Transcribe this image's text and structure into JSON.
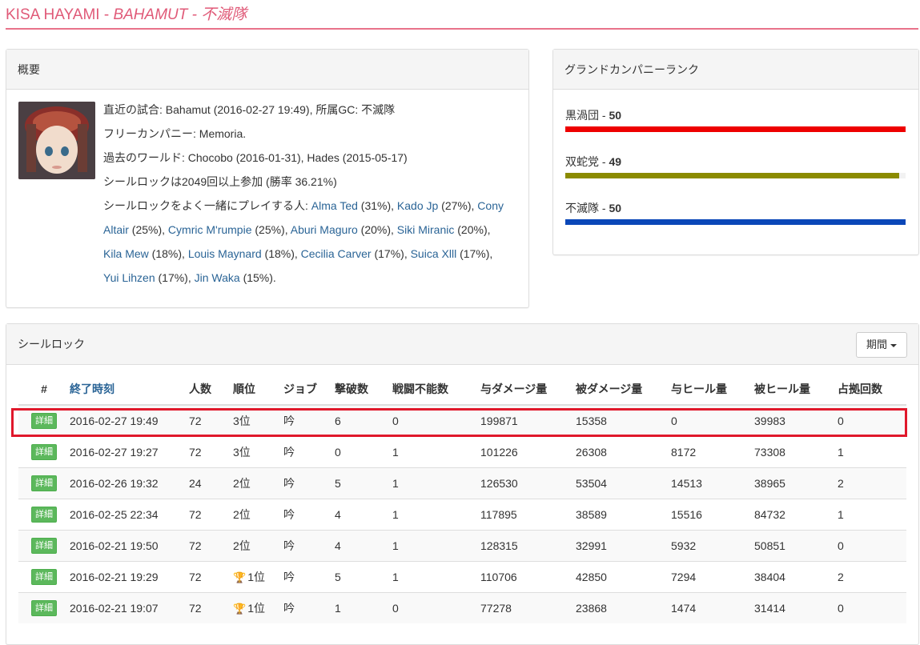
{
  "header": {
    "player": "KISA HAYAMI",
    "sep1": " - ",
    "world": "BAHAMUT",
    "sep2": " - ",
    "gc": "不滅隊",
    "accent": "#e05a78"
  },
  "overview": {
    "title": "概要",
    "line1": "直近の試合: Bahamut (2016-02-27 19:49), 所属GC: 不滅隊",
    "line2": "フリーカンパニー: Memoria.",
    "line3": "過去のワールド: Chocobo (2016-01-31), Hades (2015-05-17)",
    "line4": "シールロックは2049回以上参加 (勝率 36.21%)",
    "partners_prefix": "シールロックをよく一緒にプレイする人: ",
    "partners": [
      {
        "name": "Alma Ted",
        "pct": " (31%), "
      },
      {
        "name": "Kado Jp",
        "pct": " (27%), "
      },
      {
        "name": "Cony Altair",
        "pct": " (25%), "
      },
      {
        "name": "Cymric M'rumpie",
        "pct": " (25%), "
      },
      {
        "name": "Aburi Maguro",
        "pct": " (20%), "
      },
      {
        "name": "Siki Miranic",
        "pct": " (20%), "
      },
      {
        "name": "Kila Mew",
        "pct": " (18%), "
      },
      {
        "name": "Louis Maynard",
        "pct": " (18%), "
      },
      {
        "name": "Cecilia Carver",
        "pct": " (17%), "
      },
      {
        "name": "Suica Xlll",
        "pct": " (17%), "
      },
      {
        "name": "Yui Lihzen",
        "pct": " (17%), "
      },
      {
        "name": "Jin Waka",
        "pct": " (15%)."
      }
    ]
  },
  "gc_rank": {
    "title": "グランドカンパニーランク",
    "rows": [
      {
        "name": "黒渦団",
        "sep": " - ",
        "rank": "50",
        "fill": 1.0,
        "color": "#ee0000"
      },
      {
        "name": "双蛇党",
        "sep": " - ",
        "rank": "49",
        "fill": 0.98,
        "color": "#8b8b00"
      },
      {
        "name": "不滅隊",
        "sep": " - ",
        "rank": "50",
        "fill": 1.0,
        "color": "#0a47b8"
      }
    ]
  },
  "sealrock": {
    "title": "シールロック",
    "period_label": "期間",
    "columns": [
      "#",
      "終了時刻",
      "人数",
      "順位",
      "ジョブ",
      "撃破数",
      "戦闘不能数",
      "与ダメージ量",
      "被ダメージ量",
      "与ヒール量",
      "被ヒール量",
      "占拠回数"
    ],
    "detail_label": "詳細",
    "rows": [
      {
        "time": "2016-02-27 19:49",
        "players": "72",
        "rank": "3位",
        "trophy": false,
        "job": "吟",
        "kills": "6",
        "deaths": "0",
        "dmg": "199871",
        "taken": "15358",
        "heal": "0",
        "healed": "39983",
        "captures": "0"
      },
      {
        "time": "2016-02-27 19:27",
        "players": "72",
        "rank": "3位",
        "trophy": false,
        "job": "吟",
        "kills": "0",
        "deaths": "1",
        "dmg": "101226",
        "taken": "26308",
        "heal": "8172",
        "healed": "73308",
        "captures": "1"
      },
      {
        "time": "2016-02-26 19:32",
        "players": "24",
        "rank": "2位",
        "trophy": false,
        "job": "吟",
        "kills": "5",
        "deaths": "1",
        "dmg": "126530",
        "taken": "53504",
        "heal": "14513",
        "healed": "38965",
        "captures": "2"
      },
      {
        "time": "2016-02-25 22:34",
        "players": "72",
        "rank": "2位",
        "trophy": false,
        "job": "吟",
        "kills": "4",
        "deaths": "1",
        "dmg": "117895",
        "taken": "38589",
        "heal": "15516",
        "healed": "84732",
        "captures": "1"
      },
      {
        "time": "2016-02-21 19:50",
        "players": "72",
        "rank": "2位",
        "trophy": false,
        "job": "吟",
        "kills": "4",
        "deaths": "1",
        "dmg": "128315",
        "taken": "32991",
        "heal": "5932",
        "healed": "50851",
        "captures": "0"
      },
      {
        "time": "2016-02-21 19:29",
        "players": "72",
        "rank": "1位",
        "trophy": true,
        "job": "吟",
        "kills": "5",
        "deaths": "1",
        "dmg": "110706",
        "taken": "42850",
        "heal": "7294",
        "healed": "38404",
        "captures": "2"
      },
      {
        "time": "2016-02-21 19:07",
        "players": "72",
        "rank": "1位",
        "trophy": true,
        "job": "吟",
        "kills": "1",
        "deaths": "0",
        "dmg": "77278",
        "taken": "23868",
        "heal": "1474",
        "healed": "31414",
        "captures": "0"
      }
    ]
  }
}
